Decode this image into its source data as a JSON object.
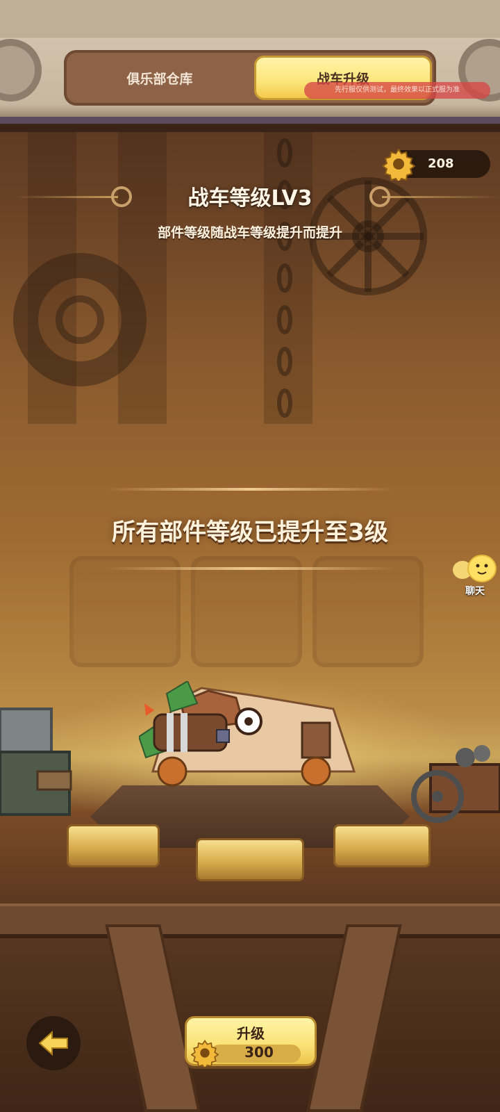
{
  "tabs": {
    "warehouse": "俱乐部仓库",
    "upgrade": "战车升级",
    "active": "upgrade"
  },
  "test_notice": "先行服仅供测试，最终效果以正式服为准",
  "currency": {
    "icon": "gear-coin-icon",
    "value": "208"
  },
  "header": {
    "title": "战车等级LV3",
    "subtitle": "部件等级随战车等级提升而提升"
  },
  "message": "所有部件等级已提升至3级",
  "chat": {
    "label": "聊天",
    "icon": "chat-bubble-icon"
  },
  "upgrade_button": {
    "label": "升级",
    "cost": "300",
    "cost_icon": "gear-coin-icon"
  },
  "back_button": {
    "icon": "back-arrow-icon"
  },
  "colors": {
    "accent_yellow": "#fce57a",
    "currency_bg": "#22140c",
    "test_banner": "#d64846",
    "background": "#8a5a2e"
  }
}
